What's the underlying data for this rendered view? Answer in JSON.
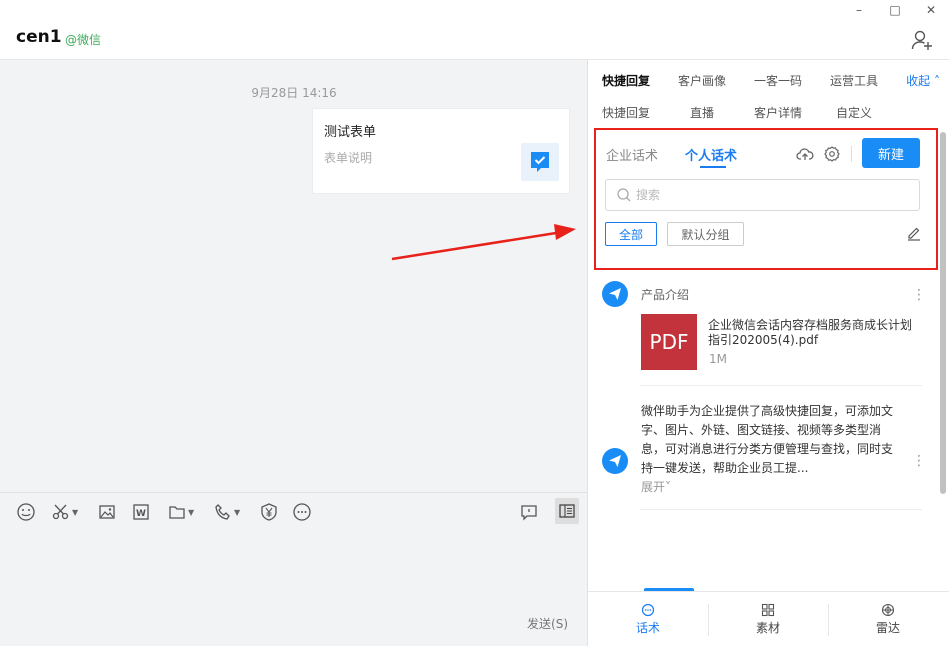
{
  "window": {
    "minimize": "–",
    "maximize": "□",
    "close": "✕"
  },
  "header": {
    "title": "cen1",
    "subtitle": "@微信"
  },
  "chat": {
    "timestamp": "9月28日 14:16",
    "card": {
      "title": "测试表单",
      "description": "表单说明"
    }
  },
  "toolbar": {
    "send_label": "发送(S)"
  },
  "panel": {
    "tabs_row1": [
      "快捷回复",
      "客户画像",
      "一客一码",
      "运营工具"
    ],
    "collapse_label": "收起",
    "tabs_row2": [
      "快捷回复",
      "直播",
      "客户详情",
      "自定义"
    ],
    "sub_tabs": [
      "企业话术",
      "个人话术"
    ],
    "new_button": "新建",
    "search_placeholder": "搜索",
    "chips": [
      "全部",
      "默认分组"
    ],
    "items": {
      "item1_label": "产品介绍",
      "pdf_label": "PDF",
      "file_name": "企业微信会话内容存档服务商成长计划指引202005(4).pdf",
      "file_size": "1M",
      "item2_text": "微伴助手为企业提供了高级快捷回复，可添加文字、图片、外链、图文链接、视频等多类型消息，可对消息进行分类方便管理与查找，同时支持一键发送，帮助企业员工提...",
      "expand_label": "展开"
    },
    "bottom_nav": [
      "话术",
      "素材",
      "雷达"
    ]
  },
  "colors": {
    "accent": "#1a8cf5",
    "highlight_box": "#e8221b",
    "wechat_green": "#3dab5a",
    "pdf_red": "#c2333b"
  }
}
